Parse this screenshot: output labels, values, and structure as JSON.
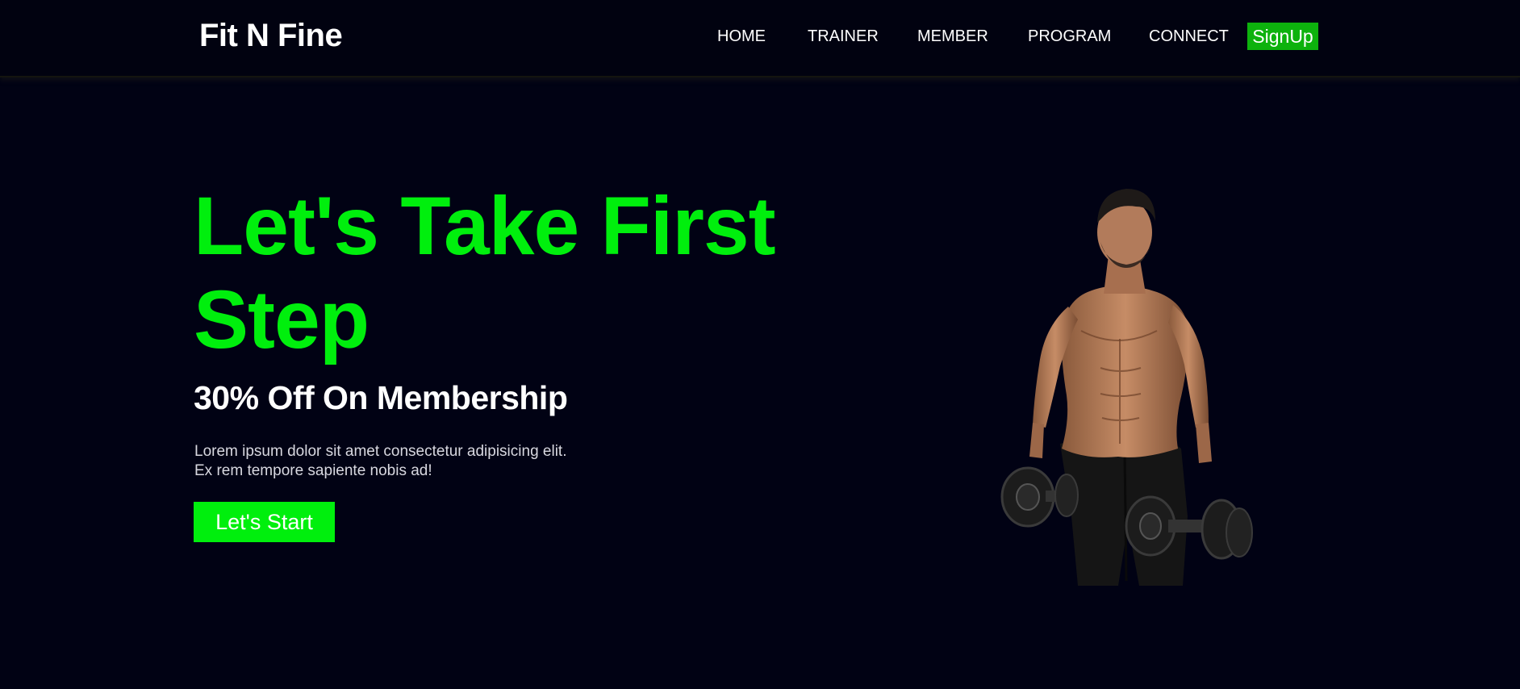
{
  "nav": {
    "brand": "Fit N Fine",
    "links": [
      {
        "label": "HOME"
      },
      {
        "label": "TRAINER"
      },
      {
        "label": "MEMBER"
      },
      {
        "label": "PROGRAM"
      },
      {
        "label": "CONNECT"
      }
    ],
    "signup_label": "SignUp"
  },
  "hero": {
    "title": "Let's Take First Step",
    "subtitle": "30% Off On Membership",
    "description": "Lorem ipsum dolor sit amet consectetur adipisicing elit. Ex rem tempore sapiente nobis ad!",
    "cta_label": "Let's Start",
    "image_icon": "fitness-man-with-dumbbells"
  },
  "colors": {
    "background": "#010214",
    "accent_green": "#00ef0d",
    "signup_green": "#0db20d"
  }
}
